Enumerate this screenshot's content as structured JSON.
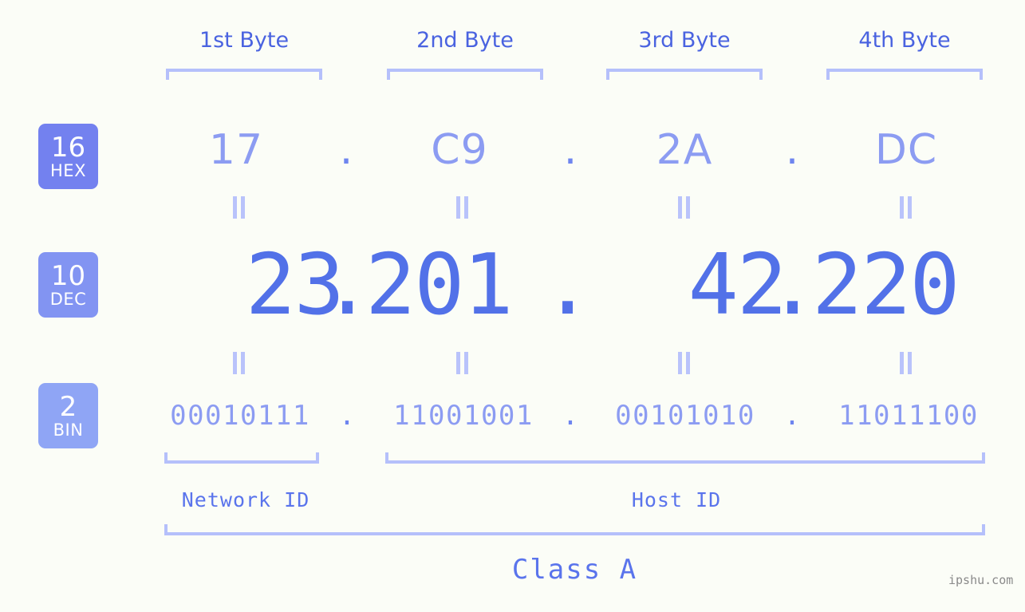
{
  "background_color": "#fbfdf7",
  "accent_color": "#5271e8",
  "bracket_color": "#b5c0fb",
  "byte_headers": [
    {
      "label": "1st Byte"
    },
    {
      "label": "2nd Byte"
    },
    {
      "label": "3rd Byte"
    },
    {
      "label": "4th Byte"
    }
  ],
  "rows": {
    "hex": {
      "badge_number": "16",
      "badge_name": "HEX",
      "separator": ".",
      "values": [
        "17",
        "C9",
        "2A",
        "DC"
      ]
    },
    "dec": {
      "badge_number": "10",
      "badge_name": "DEC",
      "separator": ".",
      "values": [
        "23",
        "201",
        "42",
        "220"
      ]
    },
    "bin": {
      "badge_number": "2",
      "badge_name": "BIN",
      "separator": ".",
      "values": [
        "00010111",
        "11001001",
        "00101010",
        "11011100"
      ]
    }
  },
  "segments": {
    "network_id": "Network ID",
    "host_id": "Host ID",
    "class": "Class A"
  },
  "watermark": "ipshu.com"
}
